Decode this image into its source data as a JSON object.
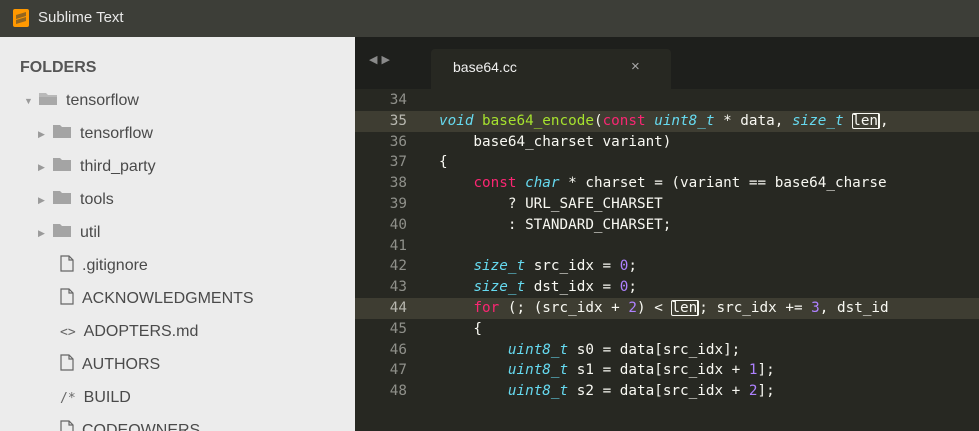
{
  "window": {
    "title": "Sublime Text"
  },
  "sidebar": {
    "header": "FOLDERS",
    "items": [
      {
        "label": "tensorflow",
        "kind": "folder-open",
        "depth": 0
      },
      {
        "label": "tensorflow",
        "kind": "folder",
        "depth": 1
      },
      {
        "label": "third_party",
        "kind": "folder",
        "depth": 1
      },
      {
        "label": "tools",
        "kind": "folder",
        "depth": 1
      },
      {
        "label": "util",
        "kind": "folder",
        "depth": 1
      },
      {
        "label": ".gitignore",
        "kind": "file",
        "depth": 1
      },
      {
        "label": "ACKNOWLEDGMENTS",
        "kind": "file",
        "depth": 1
      },
      {
        "label": "ADOPTERS.md",
        "kind": "markup",
        "depth": 1
      },
      {
        "label": "AUTHORS",
        "kind": "file",
        "depth": 1
      },
      {
        "label": "BUILD",
        "kind": "comment",
        "depth": 1
      },
      {
        "label": "CODEOWNERS",
        "kind": "file",
        "depth": 1
      }
    ]
  },
  "tabs": [
    {
      "label": "base64.cc",
      "close": "×",
      "active": true
    }
  ],
  "editor": {
    "current_line": "35",
    "lines": [
      {
        "n": "34",
        "tokens": []
      },
      {
        "n": "35",
        "tokens": [
          [
            "type",
            "void"
          ],
          [
            "",
            ""
          ],
          [
            "fn",
            " base64_encode"
          ],
          [
            "",
            "("
          ],
          [
            "kw",
            "const"
          ],
          [
            "",
            ""
          ],
          [
            "type",
            " uint8_t"
          ],
          [
            "",
            ""
          ],
          [
            "",
            "",
            " "
          ],
          [
            "",
            ""
          ]
        ]
      },
      {
        "n": "36",
        "tokens": [
          [
            "",
            "    base64_charset variant)"
          ]
        ]
      },
      {
        "n": "37",
        "tokens": [
          [
            "",
            "{"
          ]
        ]
      },
      {
        "n": "38",
        "tokens": [
          [
            "",
            "    "
          ],
          [
            "kw",
            "const"
          ],
          [
            "",
            ""
          ],
          [
            "type",
            " char"
          ],
          [
            "",
            ""
          ],
          [
            "",
            " * charset = (variant == base64_charse"
          ]
        ]
      },
      {
        "n": "39",
        "tokens": [
          [
            "",
            "        ? URL_SAFE_CHARSET"
          ]
        ]
      },
      {
        "n": "40",
        "tokens": [
          [
            "",
            "        : STANDARD_CHARSET;"
          ]
        ]
      },
      {
        "n": "41",
        "tokens": []
      },
      {
        "n": "42",
        "tokens": [
          [
            "",
            "    "
          ],
          [
            "type",
            "size_t"
          ],
          [
            "",
            " src_idx = "
          ],
          [
            "num",
            "0"
          ],
          [
            "",
            ";"
          ]
        ]
      },
      {
        "n": "43",
        "tokens": [
          [
            "",
            "    "
          ],
          [
            "type",
            "size_t"
          ],
          [
            "",
            " dst_idx = "
          ],
          [
            "num",
            "0"
          ],
          [
            "",
            ";"
          ]
        ]
      },
      {
        "n": "44",
        "tokens": [
          [
            "",
            "    "
          ],
          [
            "kw",
            "for"
          ],
          [
            "",
            " (; (src_idx + "
          ],
          [
            "num",
            "2"
          ],
          [
            "",
            ") < "
          ],
          [
            "boxed",
            "len"
          ],
          [
            "",
            "; src_idx += "
          ],
          [
            "num",
            "3"
          ],
          [
            "",
            ", dst_id"
          ]
        ]
      },
      {
        "n": "45",
        "tokens": [
          [
            "",
            "    {"
          ]
        ]
      },
      {
        "n": "46",
        "tokens": [
          [
            "",
            "        "
          ],
          [
            "type",
            "uint8_t"
          ],
          [
            "",
            " s0 = data[src_idx];"
          ]
        ]
      },
      {
        "n": "47",
        "tokens": [
          [
            "",
            "        "
          ],
          [
            "type",
            "uint8_t"
          ],
          [
            "",
            " s1 = data[src_idx + "
          ],
          [
            "num",
            "1"
          ],
          [
            "",
            "];"
          ]
        ]
      },
      {
        "n": "48",
        "tokens": [
          [
            "",
            "        "
          ],
          [
            "type",
            "uint8_t"
          ],
          [
            "",
            " s2 = data[src_idx + "
          ],
          [
            "num",
            "2"
          ],
          [
            "",
            "];"
          ]
        ]
      }
    ]
  }
}
